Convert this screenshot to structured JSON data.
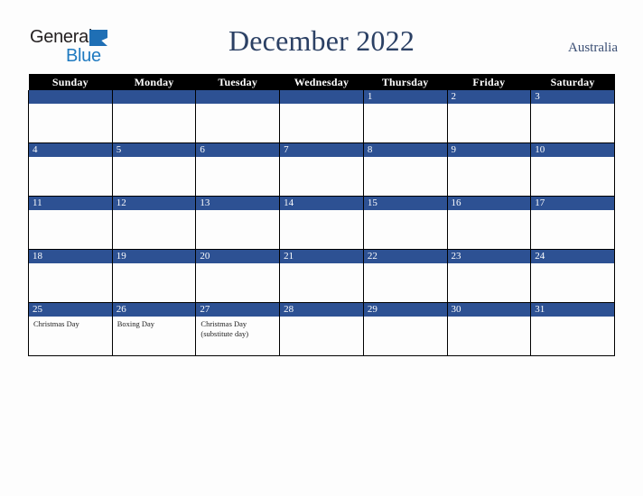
{
  "brand": {
    "name_part1": "General",
    "name_part2": "Blue",
    "triangle_icon": "triangle-icon"
  },
  "header": {
    "title": "December 2022",
    "region": "Australia"
  },
  "colors": {
    "daybar_blue": "#2d5193",
    "header_black": "#000000",
    "title_navy": "#2b4064",
    "logo_blue": "#1f7ac0",
    "page_background": "#fdfdfd"
  },
  "calendar": {
    "weekday_headers": [
      "Sunday",
      "Monday",
      "Tuesday",
      "Wednesday",
      "Thursday",
      "Friday",
      "Saturday"
    ],
    "weeks": [
      [
        {
          "date": "",
          "events": []
        },
        {
          "date": "",
          "events": []
        },
        {
          "date": "",
          "events": []
        },
        {
          "date": "",
          "events": []
        },
        {
          "date": "1",
          "events": []
        },
        {
          "date": "2",
          "events": []
        },
        {
          "date": "3",
          "events": []
        }
      ],
      [
        {
          "date": "4",
          "events": []
        },
        {
          "date": "5",
          "events": []
        },
        {
          "date": "6",
          "events": []
        },
        {
          "date": "7",
          "events": []
        },
        {
          "date": "8",
          "events": []
        },
        {
          "date": "9",
          "events": []
        },
        {
          "date": "10",
          "events": []
        }
      ],
      [
        {
          "date": "11",
          "events": []
        },
        {
          "date": "12",
          "events": []
        },
        {
          "date": "13",
          "events": []
        },
        {
          "date": "14",
          "events": []
        },
        {
          "date": "15",
          "events": []
        },
        {
          "date": "16",
          "events": []
        },
        {
          "date": "17",
          "events": []
        }
      ],
      [
        {
          "date": "18",
          "events": []
        },
        {
          "date": "19",
          "events": []
        },
        {
          "date": "20",
          "events": []
        },
        {
          "date": "21",
          "events": []
        },
        {
          "date": "22",
          "events": []
        },
        {
          "date": "23",
          "events": []
        },
        {
          "date": "24",
          "events": []
        }
      ],
      [
        {
          "date": "25",
          "events": [
            "Christmas Day"
          ]
        },
        {
          "date": "26",
          "events": [
            "Boxing Day"
          ]
        },
        {
          "date": "27",
          "events": [
            "Christmas Day",
            "(substitute day)"
          ]
        },
        {
          "date": "28",
          "events": []
        },
        {
          "date": "29",
          "events": []
        },
        {
          "date": "30",
          "events": []
        },
        {
          "date": "31",
          "events": []
        }
      ]
    ]
  }
}
